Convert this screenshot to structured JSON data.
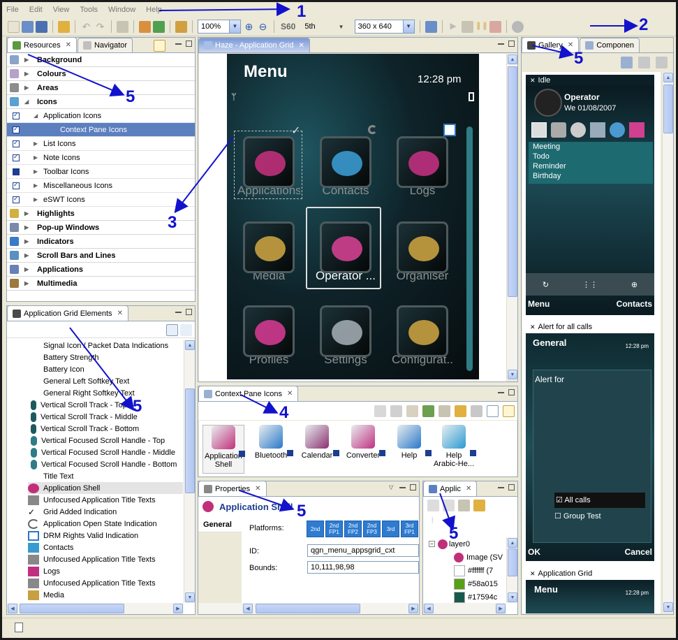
{
  "menu": [
    "File",
    "Edit",
    "View",
    "Tools",
    "Window",
    "Help"
  ],
  "toolbar": {
    "zoom": "100%",
    "platform": "S60",
    "edition": "5th",
    "resolution": "360 x 640"
  },
  "resources": {
    "tabs": [
      "Resources",
      "Navigator"
    ],
    "categories": [
      {
        "label": "Background",
        "color": "#8aa4c8",
        "expanded": false
      },
      {
        "label": "Colours",
        "color": "#b6a2c8",
        "expanded": false
      },
      {
        "label": "Areas",
        "color": "#8c8c8c",
        "expanded": false
      },
      {
        "label": "Icons",
        "color": "#5aa0d0",
        "expanded": true
      }
    ],
    "icon_children": [
      {
        "label": "Application Icons",
        "level": 1,
        "expanded": true,
        "selected": false,
        "filled": false
      },
      {
        "label": "Context Pane Icons",
        "level": 2,
        "expanded": false,
        "selected": true,
        "filled": false
      },
      {
        "label": "List Icons",
        "level": 1,
        "expanded": false,
        "selected": false,
        "filled": false
      },
      {
        "label": "Note Icons",
        "level": 1,
        "expanded": false,
        "selected": false,
        "filled": false
      },
      {
        "label": "Toolbar Icons",
        "level": 1,
        "expanded": false,
        "selected": false,
        "filled": true
      },
      {
        "label": "Miscellaneous Icons",
        "level": 1,
        "expanded": false,
        "selected": false,
        "filled": false
      },
      {
        "label": "eSWT Icons",
        "level": 1,
        "expanded": false,
        "selected": false,
        "filled": false
      }
    ],
    "more": [
      {
        "label": "Highlights",
        "color": "#d0b040"
      },
      {
        "label": "Pop-up Windows",
        "color": "#7a8aa8"
      },
      {
        "label": "Indicators",
        "color": "#3a7ac8"
      },
      {
        "label": "Scroll Bars and Lines",
        "color": "#5890c0"
      },
      {
        "label": "Applications",
        "color": "#6880b8"
      },
      {
        "label": "Multimedia",
        "color": "#9a7a40"
      }
    ]
  },
  "grid_elements": {
    "tab": "Application Grid Elements",
    "items": [
      {
        "label": "Signal Icon / Packet Data Indications",
        "icon": "none"
      },
      {
        "label": "Battery Strength",
        "icon": "none"
      },
      {
        "label": "Battery Icon",
        "icon": "none"
      },
      {
        "label": "General Left Softkey Text",
        "icon": "none"
      },
      {
        "label": "General Right Softkey Text",
        "icon": "none"
      },
      {
        "label": "Vertical Scroll Track - Top",
        "icon": "teal"
      },
      {
        "label": "Vertical Scroll Track - Middle",
        "icon": "teal"
      },
      {
        "label": "Vertical Scroll Track - Bottom",
        "icon": "teal"
      },
      {
        "label": "Vertical Focused Scroll Handle - Top",
        "icon": "teal2"
      },
      {
        "label": "Vertical Focused Scroll Handle - Middle",
        "icon": "teal2"
      },
      {
        "label": "Vertical Focused Scroll Handle - Bottom",
        "icon": "teal2"
      },
      {
        "label": "Title Text",
        "icon": "none"
      },
      {
        "label": "Application Shell",
        "icon": "appshell"
      },
      {
        "label": "Unfocused Application Title Texts",
        "icon": "gray"
      },
      {
        "label": "Grid Added Indication",
        "icon": "check"
      },
      {
        "label": "Application Open State Indication",
        "icon": "spin"
      },
      {
        "label": "DRM Rights Valid Indication",
        "icon": "drm"
      },
      {
        "label": "Contacts",
        "icon": "contacts"
      },
      {
        "label": "Unfocused Application Title Texts",
        "icon": "gray"
      },
      {
        "label": "Logs",
        "icon": "logs"
      },
      {
        "label": "Unfocused Application Title Texts",
        "icon": "gray"
      },
      {
        "label": "Media",
        "icon": "media"
      }
    ]
  },
  "editor": {
    "tab": "Haze - Application Grid",
    "title": "Menu",
    "time": "12:28 pm",
    "apps": [
      {
        "label": "Applications",
        "color": "#c0307a"
      },
      {
        "label": "Contacts",
        "color": "#3a9ad0"
      },
      {
        "label": "Logs",
        "color": "#c03080"
      },
      {
        "label": "Media",
        "color": "#c8a040"
      },
      {
        "label": "Operator ...",
        "color": "#d04090"
      },
      {
        "label": "Organiser",
        "color": "#c8a040"
      },
      {
        "label": "Profiles",
        "color": "#d03a90"
      },
      {
        "label": "Settings",
        "color": "#a0a8b0"
      },
      {
        "label": "Configurat..",
        "color": "#c8a040"
      }
    ]
  },
  "context_pane": {
    "tab": "Context Pane Icons",
    "items": [
      {
        "label": "Application\nShell",
        "color": "#c0307a"
      },
      {
        "label": "Bluetooth",
        "color": "#2a78c8"
      },
      {
        "label": "Calendar",
        "color": "#8a3070"
      },
      {
        "label": "Converter",
        "color": "#c03080"
      },
      {
        "label": "Help",
        "color": "#2a78c8"
      },
      {
        "label": "Help\nArabic-He...",
        "color": "#2a9ad0"
      }
    ]
  },
  "properties": {
    "tab": "Properties",
    "heading": "Application Shell",
    "section": "General",
    "platforms_label": "Platforms:",
    "platforms": [
      "2nd",
      "2nd FP1",
      "2nd FP2",
      "2nd FP3",
      "3rd",
      "3rd FP1"
    ],
    "id_label": "ID:",
    "id_value": "qgn_menu_appsgrid_cxt",
    "bounds_label": "Bounds:",
    "bounds_value": "10,111,98,98"
  },
  "layers": {
    "tab": "Applic",
    "items": [
      {
        "label": "layer0",
        "color": ""
      },
      {
        "label": "Image (SV",
        "color": ""
      },
      {
        "label": "#ffffff (7",
        "color": "#ffffff"
      },
      {
        "label": "#58a015",
        "color": "#58a015"
      },
      {
        "label": "#17594c",
        "color": "#17594c"
      }
    ]
  },
  "gallery": {
    "tabs": [
      "Gallery",
      "Componen"
    ],
    "idle_title": "Idle",
    "operator": "Operator",
    "date": "We 01/08/2007",
    "idle_items": [
      "Meeting",
      "Todo",
      "Reminder",
      "Birthday"
    ],
    "left_soft": "Menu",
    "right_soft": "Contacts",
    "alert_title": "Alert for all calls",
    "general": "General",
    "time": "12:28 pm",
    "alert_for": "Alert for",
    "all_calls": "All calls",
    "group_test": "Group Test",
    "ok": "OK",
    "cancel": "Cancel",
    "grid_title": "Application Grid",
    "grid_menu": "Menu"
  },
  "annotations": [
    "1",
    "2",
    "3",
    "4",
    "5"
  ]
}
